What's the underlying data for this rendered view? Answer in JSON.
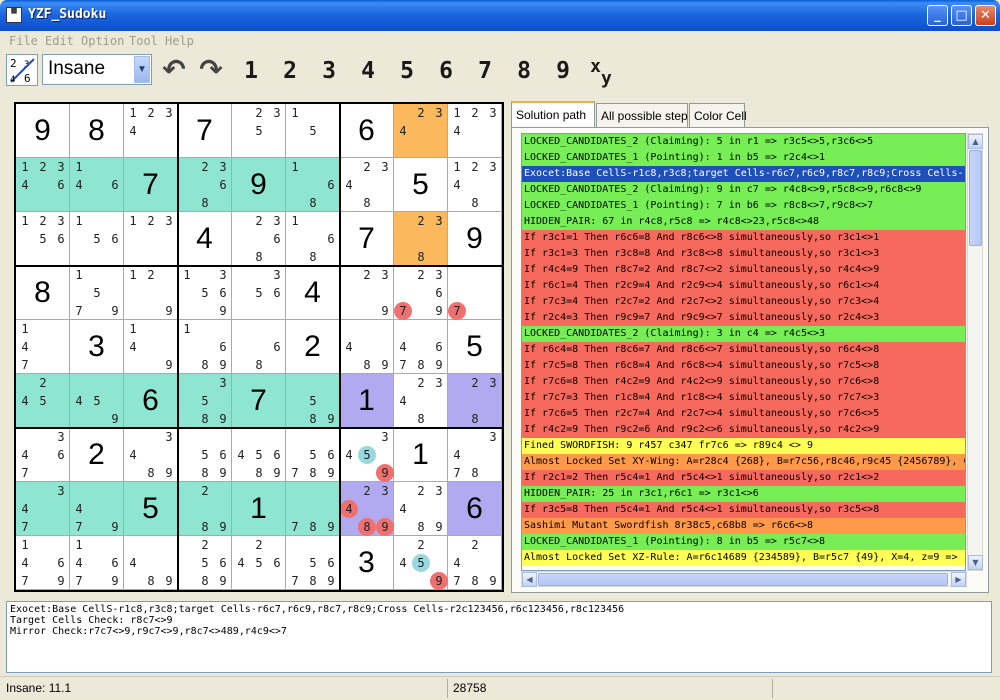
{
  "window": {
    "title": "YZF_Sudoku",
    "min": "_",
    "max": "□",
    "close": "✕"
  },
  "menu": [
    "File",
    "Edit",
    "Option",
    "Tool",
    "Help"
  ],
  "toolbar": {
    "level": "Insane",
    "undo_icon": "undo-arrow-icon",
    "redo_icon": "redo-arrow-icon",
    "digits": [
      "1",
      "2",
      "3",
      "4",
      "5",
      "6",
      "7",
      "8",
      "9"
    ],
    "xy_label": "xy"
  },
  "colors": {
    "teal": "#8ee6d2",
    "orange": "#fbb85c",
    "purple": "#b2aaf0",
    "green": "#77ee55",
    "red": "#f66a5e",
    "blue": "#1f4fb9",
    "yellow": "#ffff55",
    "amber": "#ff9a4a"
  },
  "board": [
    [
      {
        "v": "9"
      },
      {
        "v": "8"
      },
      {
        "c": "1234"
      },
      {
        "v": "7"
      },
      {
        "c": "235"
      },
      {
        "c": "15"
      },
      {
        "v": "6"
      },
      {
        "c": "234",
        "bg": "orange"
      },
      {
        "c": "1234"
      }
    ],
    [
      {
        "c": "12346",
        "bg": "teal"
      },
      {
        "c": "146",
        "bg": "teal"
      },
      {
        "v": "7",
        "bg": "teal"
      },
      {
        "c": "2368",
        "bg": "teal"
      },
      {
        "v": "9",
        "bg": "teal"
      },
      {
        "c": "168",
        "bg": "teal"
      },
      {
        "c": "2348"
      },
      {
        "v": "5"
      },
      {
        "c": "12348"
      }
    ],
    [
      {
        "c": "12356"
      },
      {
        "c": "156"
      },
      {
        "c": "123"
      },
      {
        "v": "4"
      },
      {
        "c": "2368"
      },
      {
        "c": "168"
      },
      {
        "v": "7"
      },
      {
        "c": "238",
        "bg": "orange"
      },
      {
        "v": "9"
      }
    ],
    [
      {
        "v": "8"
      },
      {
        "c": "1579"
      },
      {
        "c": "129"
      },
      {
        "c": "13569"
      },
      {
        "c": "356"
      },
      {
        "v": "4"
      },
      {
        "c": "239"
      },
      {
        "c": "23679",
        "red": {
          "7": 1
        }
      },
      {
        "c": "7",
        "red": {
          "7": 1
        },
        "only": "7"
      }
    ],
    [
      {
        "c": "147"
      },
      {
        "v": "3"
      },
      {
        "c": "149"
      },
      {
        "c": "1689"
      },
      {
        "c": "68"
      },
      {
        "v": "2"
      },
      {
        "c": "489"
      },
      {
        "c": "46789"
      },
      {
        "v": "5"
      }
    ],
    [
      {
        "c": "245",
        "bg": "teal"
      },
      {
        "c": "459",
        "bg": "teal"
      },
      {
        "v": "6",
        "bg": "teal"
      },
      {
        "c": "3589",
        "bg": "teal"
      },
      {
        "v": "7",
        "bg": "teal"
      },
      {
        "c": "589",
        "bg": "teal"
      },
      {
        "v": "1",
        "bg": "purple"
      },
      {
        "c": "2348"
      },
      {
        "c": "238",
        "bg": "purple"
      }
    ],
    [
      {
        "c": "3467"
      },
      {
        "v": "2"
      },
      {
        "c": "3489"
      },
      {
        "c": "5689"
      },
      {
        "c": "45689"
      },
      {
        "c": "56789"
      },
      {
        "c": "3459",
        "cyan": {
          "5": 1
        },
        "red": {
          "9": 1
        }
      },
      {
        "v": "1"
      },
      {
        "c": "3478"
      }
    ],
    [
      {
        "c": "347",
        "bg": "teal"
      },
      {
        "c": "479",
        "bg": "teal"
      },
      {
        "v": "5",
        "bg": "teal"
      },
      {
        "c": "289",
        "bg": "teal"
      },
      {
        "v": "1",
        "bg": "teal"
      },
      {
        "c": "789",
        "bg": "teal"
      },
      {
        "c": "23489",
        "bg": "purple",
        "red": {
          "4": 1,
          "8": 1,
          "9": 1
        }
      },
      {
        "c": "23489"
      },
      {
        "v": "6",
        "bg": "purple"
      }
    ],
    [
      {
        "c": "14679"
      },
      {
        "c": "14679"
      },
      {
        "c": "489"
      },
      {
        "c": "25689"
      },
      {
        "c": "2456"
      },
      {
        "c": "56789"
      },
      {
        "v": "3"
      },
      {
        "c": "2459",
        "cyan": {
          "5": 1
        },
        "red": {
          "9": 1
        }
      },
      {
        "c": "24789"
      }
    ]
  ],
  "tabs": [
    "Solution path",
    "All possible step",
    "Color Cell"
  ],
  "steps": [
    {
      "t": "LOCKED_CANDIDATES_2 (Claiming): 5 in r1 => r3c5<>5,r3c6<>5",
      "k": "green"
    },
    {
      "t": "LOCKED_CANDIDATES_1 (Pointing): 1 in b5 => r2c4<>1",
      "k": "green"
    },
    {
      "t": "Exocet:Base CellS-r1c8,r3c8;target Cells-r6c7,r6c9,r8c7,r8c9;Cross Cells-r2c123456,r6c123456",
      "k": "blue"
    },
    {
      "t": "LOCKED_CANDIDATES_2 (Claiming): 9 in c7 => r4c8<>9,r5c8<>9,r6c8<>9",
      "k": "green"
    },
    {
      "t": "LOCKED_CANDIDATES_1 (Pointing): 7 in b6 => r8c8<>7,r9c8<>7",
      "k": "green"
    },
    {
      "t": "HIDDEN_PAIR: 67 in r4c8,r5c8 => r4c8<>23,r5c8<>48",
      "k": "green"
    },
    {
      "t": "If r3c1=1 Then r6c6=8 And r8c6<>8 simultaneously,so r3c1<>1",
      "k": "red"
    },
    {
      "t": "If r3c1=3 Then r3c8=8 And r3c8<>8 simultaneously,so r3c1<>3",
      "k": "red"
    },
    {
      "t": "If r4c4=9 Then r8c7=2 And r8c7<>2 simultaneously,so r4c4<>9",
      "k": "red"
    },
    {
      "t": "If r6c1=4 Then r2c9=4 And r2c9<>4 simultaneously,so r6c1<>4",
      "k": "red"
    },
    {
      "t": "If r7c3=4 Then r2c7=2 And r2c7<>2 simultaneously,so r7c3<>4",
      "k": "red"
    },
    {
      "t": "If r2c4=3 Then r9c9=7 And r9c9<>7 simultaneously,so r2c4<>3",
      "k": "red"
    },
    {
      "t": "LOCKED_CANDIDATES_2 (Claiming): 3 in c4 => r4c5<>3",
      "k": "green"
    },
    {
      "t": "If r6c4=8 Then r8c6=7 And r8c6<>7 simultaneously,so r6c4<>8",
      "k": "red"
    },
    {
      "t": "If r7c5=8 Then r6c8=4 And r6c8<>4 simultaneously,so r7c5<>8",
      "k": "red"
    },
    {
      "t": "If r7c6=8 Then r4c2=9 And r4c2<>9 simultaneously,so r7c6<>8",
      "k": "red"
    },
    {
      "t": "If r7c7=3 Then r1c8=4 And r1c8<>4 simultaneously,so r7c7<>3",
      "k": "red"
    },
    {
      "t": "If r7c6=5 Then r2c7=4 And r2c7<>4 simultaneously,so r7c6<>5",
      "k": "red"
    },
    {
      "t": "If r4c2=9 Then r9c2=6 And r9c2<>6 simultaneously,so r4c2<>9",
      "k": "red"
    },
    {
      "t": "Fined SWORDFISH: 9 r457 c347 fr7c6 => r89c4 <> 9",
      "k": "yellow"
    },
    {
      "t": "Almost Locked Set XY-Wing: A=r28c4 {268}, B=r7c56,r8c46,r9c45 {2456789}, C=",
      "k": "amber"
    },
    {
      "t": "If r2c1=2 Then r5c4=1 And r5c4<>1 simultaneously,so r2c1<>2",
      "k": "red"
    },
    {
      "t": "HIDDEN_PAIR: 25 in r3c1,r6c1 => r3c1<>6",
      "k": "green"
    },
    {
      "t": "If r3c5=8 Then r5c4=1 And r5c4<>1 simultaneously,so r3c5<>8",
      "k": "red"
    },
    {
      "t": "Sashimi Mutant Swordfish 8r38c5,c68b8 => r6c6<>8",
      "k": "amber"
    },
    {
      "t": "LOCKED_CANDIDATES_1 (Pointing): 8 in b5 => r5c7<>8",
      "k": "green"
    },
    {
      "t": "Almost Locked Set XZ-Rule: A=r6c14689 {234589}, B=r5c7 {49}, X=4, z=9 =>",
      "k": "yellow"
    }
  ],
  "info": [
    "Exocet:Base CellS-r1c8,r3c8;target Cells-r6c7,r6c9,r8c7,r8c9;Cross Cells-r2c123456,r6c123456,r8c123456",
    "Target Cells Check: r8c7<>9",
    "Mirror Check:r7c7<>9,r9c7<>9,r8c7<>489,r4c9<>7"
  ],
  "status": {
    "level": "Insane: 11.1",
    "count": "28758"
  }
}
